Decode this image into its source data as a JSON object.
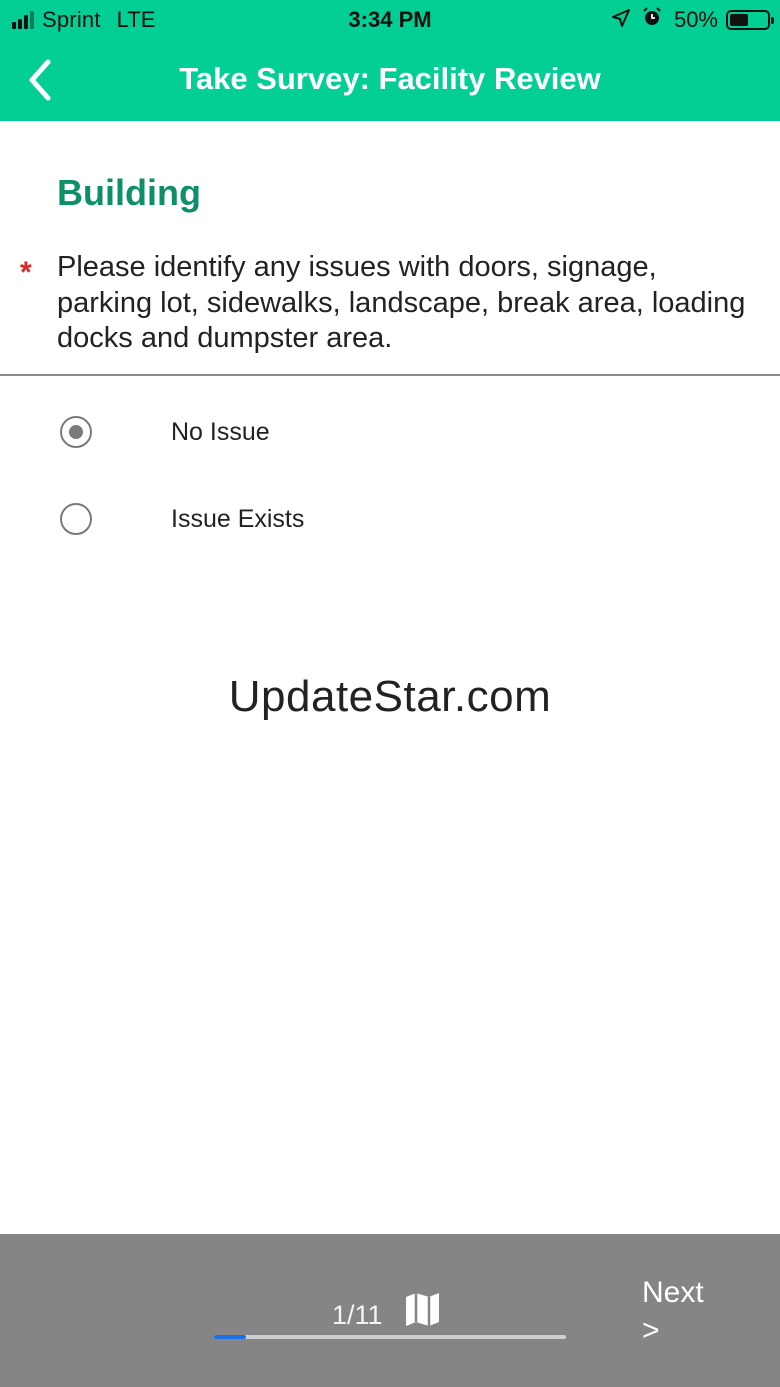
{
  "status_bar": {
    "carrier": "Sprint",
    "network": "LTE",
    "time": "3:34 PM",
    "battery": "50%",
    "battery_level": 0.5,
    "icons": [
      "signal-icon",
      "location-arrow-icon",
      "alarm-clock-icon",
      "battery-icon"
    ]
  },
  "nav": {
    "title": "Take Survey: Facility Review",
    "back_icon": "chevron-left-icon"
  },
  "colors": {
    "header_bg": "#03cf95",
    "section_title": "#0d8f6a",
    "required": "#e32222",
    "footer_bg": "#858585",
    "progress": "#1a73e8"
  },
  "survey": {
    "section_title": "Building",
    "required_marker": "*",
    "question": "Please identify any issues with doors, signage, parking lot, sidewalks, landscape, break area, loading docks and dumpster area.",
    "options": [
      {
        "label": "No Issue",
        "selected": true
      },
      {
        "label": "Issue Exists",
        "selected": false
      }
    ]
  },
  "watermark": "UpdateStar.com",
  "footer": {
    "page_indicator": "1/11",
    "progress_fraction": 0.09,
    "map_icon": "map-icon",
    "next_label": "Next",
    "next_arrow": ">"
  }
}
